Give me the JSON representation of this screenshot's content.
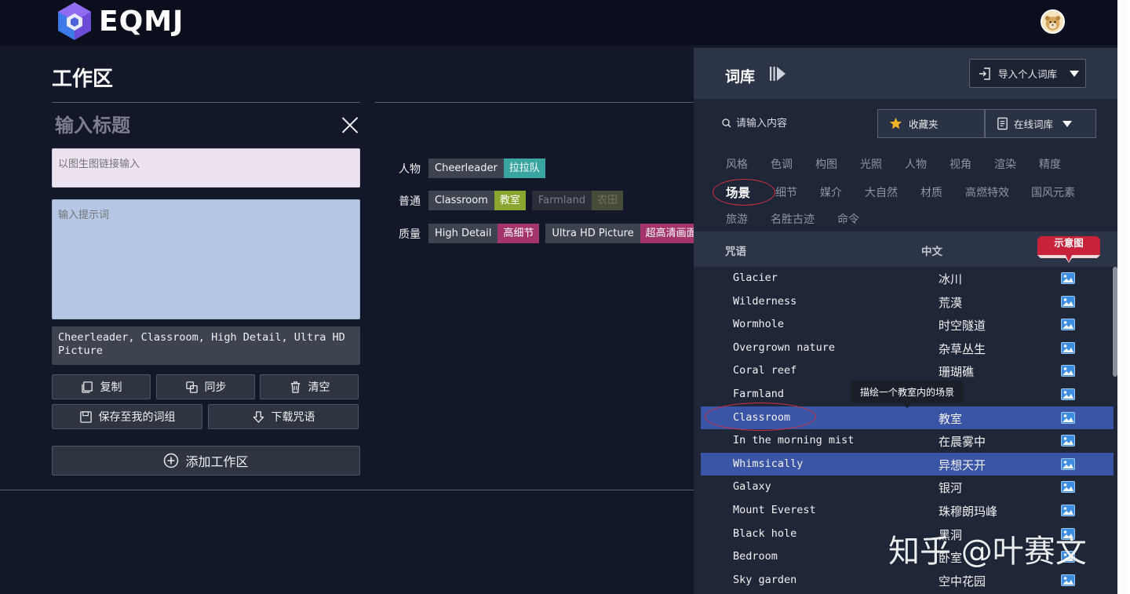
{
  "header": {
    "logo_text": "EQMJ"
  },
  "work": {
    "title": "工作区",
    "title_placeholder": "输入标题",
    "img_link_placeholder": "以图生图链接输入",
    "prompt_placeholder": "输入提示词",
    "result_text": "Cheerleader, Classroom, High Detail, Ultra HD Picture",
    "buttons": {
      "copy": "复制",
      "sync": "同步",
      "clear": "清空",
      "save": "保存至我的词组",
      "download": "下载咒语",
      "add": "添加工作区"
    }
  },
  "tag_rows": [
    {
      "label": "人物",
      "tags": [
        {
          "en": "Cheerleader",
          "zh": "拉拉队",
          "color": "#3aa5a0"
        }
      ]
    },
    {
      "label": "普通",
      "tags": [
        {
          "en": "Classroom",
          "zh": "教室",
          "color": "#8aa62e"
        },
        {
          "en": "Farmland",
          "zh": "农田",
          "dim": true
        }
      ]
    },
    {
      "label": "质量",
      "tags": [
        {
          "en": "High Detail",
          "zh": "高细节",
          "color": "#a4356b"
        },
        {
          "en": "Ultra HD Picture",
          "zh": "超高清画面",
          "color": "#a4356b"
        }
      ]
    }
  ],
  "library": {
    "title": "词库",
    "import_label": "导入个人词库",
    "search_placeholder": "请输入内容",
    "fav_label": "收藏夹",
    "online_label": "在线词库",
    "categories_row1": [
      "风格",
      "色调",
      "构图",
      "光照",
      "人物",
      "视角",
      "渲染",
      "精度"
    ],
    "categories_row2": [
      "场景",
      "细节",
      "媒介",
      "大自然",
      "材质",
      "高燃特效",
      "国风元素"
    ],
    "categories_row3": [
      "旅游",
      "名胜古迹",
      "命令"
    ],
    "active_category": "场景",
    "col_spell": "咒语",
    "col_cn": "中文",
    "col_preview": "示意图",
    "rows": [
      {
        "en": "Glacier",
        "cn": "冰川",
        "selected": false
      },
      {
        "en": "Wilderness",
        "cn": "荒漠",
        "selected": false
      },
      {
        "en": "Wormhole",
        "cn": "时空隧道",
        "selected": false
      },
      {
        "en": "Overgrown nature",
        "cn": "杂草丛生",
        "selected": false
      },
      {
        "en": "Coral reef",
        "cn": "珊瑚礁",
        "selected": false
      },
      {
        "en": "Farmland",
        "cn": "",
        "selected": false
      },
      {
        "en": "Classroom",
        "cn": "教室",
        "selected": true
      },
      {
        "en": "In the morning mist",
        "cn": "在晨雾中",
        "selected": false
      },
      {
        "en": "Whimsically",
        "cn": "异想天开",
        "selected": true
      },
      {
        "en": "Galaxy",
        "cn": "银河",
        "selected": false
      },
      {
        "en": "Mount Everest",
        "cn": "珠穆朗玛峰",
        "selected": false
      },
      {
        "en": "Black hole",
        "cn": "黑洞",
        "selected": false
      },
      {
        "en": "Bedroom",
        "cn": "卧室",
        "selected": false
      },
      {
        "en": "Sky garden",
        "cn": "空中花园",
        "selected": false
      }
    ],
    "tooltip": "描绘一个教室内的场景"
  },
  "watermark": "知乎 @叶赛文",
  "colors": {
    "accent_selected": "#3a54a6",
    "ribbon": "#c8213a",
    "annotation": "#d3323a"
  }
}
